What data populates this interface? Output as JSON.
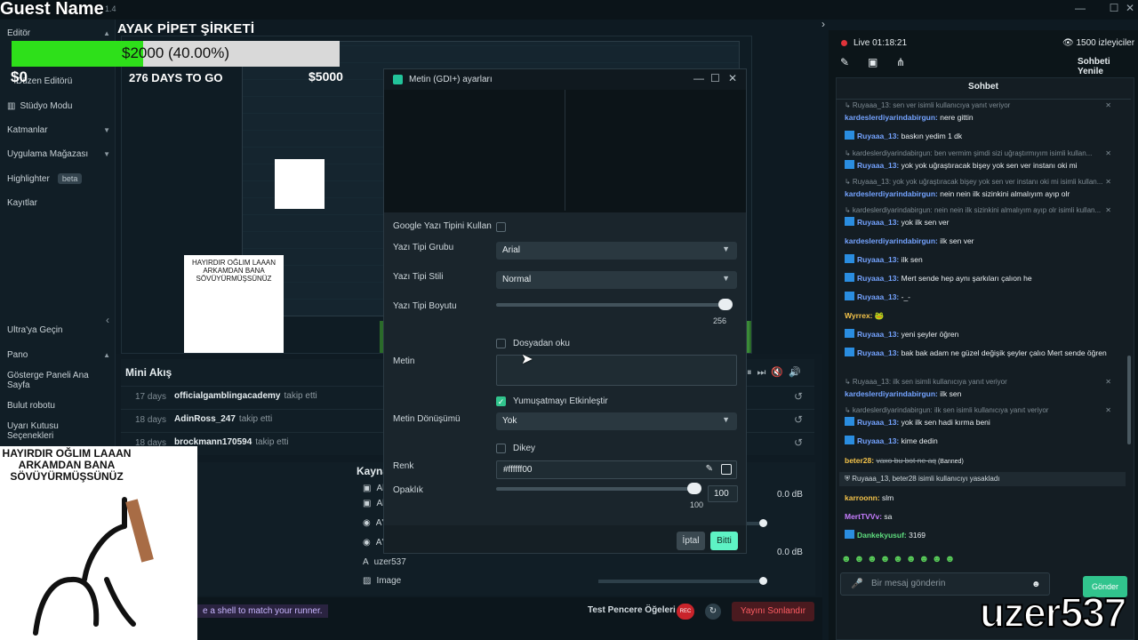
{
  "overlay": {
    "guest_name": "Guest Name",
    "stream_title": "AYAK PİPET ŞİRKETİ",
    "goal_text": "$2000 (40.00%)",
    "goal_progress": 0.4,
    "goal_min": "$0",
    "goal_max": "$5000",
    "days_to_go": "276 DAYS TO GO",
    "webcam_caption": "HAYIRDIR OĞLIM LAAAN ARKAMDAN BANA SÖVÜYÜRMÜŞSÜNÜZ",
    "watermark": "uzer537"
  },
  "window": {
    "version": "1.4",
    "minimize": "—",
    "maximize": "☐",
    "close": "✕"
  },
  "sidebar": {
    "items": [
      {
        "label": "Editör",
        "chev": "▲"
      },
      {
        "label": "Düzen Editörü"
      },
      {
        "label": "Stüdyo Modu"
      },
      {
        "label": "Katmanlar",
        "chev": "▼"
      },
      {
        "label": "Uygulama Mağazası",
        "chev": "▼"
      },
      {
        "label": "Highlighter",
        "badge": "beta"
      },
      {
        "label": "Kayıtlar"
      },
      {
        "label": "Ultra'ya Geçin"
      },
      {
        "label": "Pano",
        "chev": "▲"
      },
      {
        "label": "Gösterge Paneli Ana Sayfa"
      },
      {
        "label": "Bulut robotu"
      },
      {
        "label": "Uyarı Kutusu Seçenekleri"
      }
    ],
    "collapse": "‹"
  },
  "mini_feed": {
    "title": "Mini Akış",
    "rows": [
      {
        "age": "17 days",
        "user": "officialgamblingacademy",
        "action": "takip etti"
      },
      {
        "age": "18 days",
        "user": "AdinRoss_247",
        "action": "takip etti"
      },
      {
        "age": "18 days",
        "user": "brockmann170594",
        "action": "takip etti"
      }
    ],
    "replay": "↺"
  },
  "sources": {
    "title": "Kaynak",
    "items": [
      {
        "icon": "▣",
        "label": "Al"
      },
      {
        "icon": "▣",
        "label": "Al"
      },
      {
        "icon": "◉",
        "label": "A'"
      },
      {
        "icon": "◉",
        "label": "A'"
      },
      {
        "icon": "A",
        "label": "uzer537"
      },
      {
        "icon": "▨",
        "label": "Image"
      }
    ],
    "db": [
      "0.0 dB",
      "0.0 dB"
    ]
  },
  "bottom": {
    "ticker": "e a shell to match your runner.",
    "test_windows": "Test Pencere Öğeleri",
    "rec": "REC",
    "end_stream": "Yayını Sonlandır"
  },
  "dialog": {
    "title": "Metin (GDI+) ayarları",
    "google_font_label": "Google Yazı Tipini Kullan",
    "font_family_label": "Yazı Tipi Grubu",
    "font_family_value": "Arial",
    "font_style_label": "Yazı Tipi Stili",
    "font_style_value": "Normal",
    "font_size_label": "Yazı Tipi Boyutu",
    "font_size_value": "256",
    "read_file_label": "Dosyadan oku",
    "text_label": "Metin",
    "smoothing_label": "Yumuşatmayı Etkinleştir",
    "transform_label": "Metin Dönüşümü",
    "transform_value": "Yok",
    "vertical_label": "Dikey",
    "color_label": "Renk",
    "color_value": "#ffffff00",
    "opacity_label": "Opaklık",
    "opacity_value": "100",
    "opacity_slider_value": "100",
    "cancel": "İptal",
    "done": "Bitti"
  },
  "chat_header": {
    "live": "Live 01:18:21",
    "viewers": "1500 izleyiciler",
    "popout": "Sohbeti Yenile",
    "title": "Sohbet"
  },
  "chat": {
    "messages": [
      {
        "type": "reply",
        "text": "Ruyaaa_13: sen ver isimli kullanıcıya yanıt veriyor"
      },
      {
        "type": "msg",
        "user": "kardeslerdiyarindabirgun",
        "text": "nere gittin",
        "ucls": "u"
      },
      {
        "type": "msg",
        "user": "Ruyaaa_13",
        "text": "baskın yedim 1 dk",
        "ucls": "u",
        "icon": true
      },
      {
        "type": "reply",
        "text": "kardeslerdiyarindabirgun: ben vermim şimdi sizi uğraştırmıyım isimli kullan..."
      },
      {
        "type": "msg",
        "user": "Ruyaaa_13",
        "text": "yok yok uğraştıracak bişey yok sen ver instanı oki mi",
        "ucls": "u",
        "icon": true
      },
      {
        "type": "reply",
        "text": "Ruyaaa_13: yok yok uğraştıracak bişey yok sen ver instanı oki mi isimli kullan..."
      },
      {
        "type": "msg",
        "user": "kardeslerdiyarindabirgun",
        "text": "nein nein ilk sizinkini almalıyım ayıp olr",
        "ucls": "u"
      },
      {
        "type": "reply",
        "text": "kardeslerdiyarindabirgun: nein nein ilk sizinkini almalıyım ayıp olr isimli kullan..."
      },
      {
        "type": "msg",
        "user": "Ruyaaa_13",
        "text": "yok ilk sen ver",
        "ucls": "u",
        "icon": true
      },
      {
        "type": "msg",
        "user": "kardeslerdiyarindabirgun",
        "text": "ilk sen ver",
        "ucls": "u"
      },
      {
        "type": "msg",
        "user": "Ruyaaa_13",
        "text": "ilk sen",
        "ucls": "u",
        "icon": true
      },
      {
        "type": "msg",
        "user": "Ruyaaa_13",
        "text": "Mert sende hep aynı şarkıları çalıon he",
        "ucls": "u",
        "icon": true
      },
      {
        "type": "msg",
        "user": "Ruyaaa_13",
        "text": "-_-",
        "ucls": "u",
        "icon": true
      },
      {
        "type": "msg",
        "user": "Wyrrex",
        "text": "🐸",
        "ucls": "u2"
      },
      {
        "type": "msg",
        "user": "Ruyaaa_13",
        "text": "yeni şeyler öğren",
        "ucls": "u",
        "icon": true
      },
      {
        "type": "msg",
        "user": "Ruyaaa_13",
        "text": "bak bak adam ne güzel değişik şeyler çalıo Mert sende öğren",
        "ucls": "u",
        "icon": true
      },
      {
        "type": "reply",
        "text": "Ruyaaa_13: ilk sen isimli kullanıcıya yanıt veriyor"
      },
      {
        "type": "msg",
        "user": "kardeslerdiyarindabirgun",
        "text": "ilk sen",
        "ucls": "u"
      },
      {
        "type": "reply",
        "text": "kardeslerdiyarindabirgun: ilk sen isimli kullanıcıya yanıt veriyor"
      },
      {
        "type": "msg",
        "user": "Ruyaaa_13",
        "text": "yok ilk sen hadi kırma beni",
        "ucls": "u",
        "icon": true
      },
      {
        "type": "msg",
        "user": "Ruyaaa_13",
        "text": "kime dedin",
        "ucls": "u",
        "icon": true
      },
      {
        "type": "banned",
        "user": "beter28",
        "text": "vaxo bu bot ne aq",
        "tag": "(Banned)"
      },
      {
        "type": "ban",
        "text": "Ruyaaa_13, beter28 isimli kullanıcıyı yasakladı"
      },
      {
        "type": "msg",
        "user": "karroonn",
        "text": "slm",
        "ucls": "u2"
      },
      {
        "type": "msg",
        "user": "MertTVVv",
        "text": "sa",
        "ucls": "u4"
      },
      {
        "type": "msg",
        "user": "Dankekyusuf",
        "text": "3169",
        "ucls": "u3",
        "icon": true
      }
    ],
    "emotes": "☻☻☻☻☻☻☻☻☻",
    "input_placeholder": "Bir mesaj gönderin",
    "send": "Gönder"
  }
}
